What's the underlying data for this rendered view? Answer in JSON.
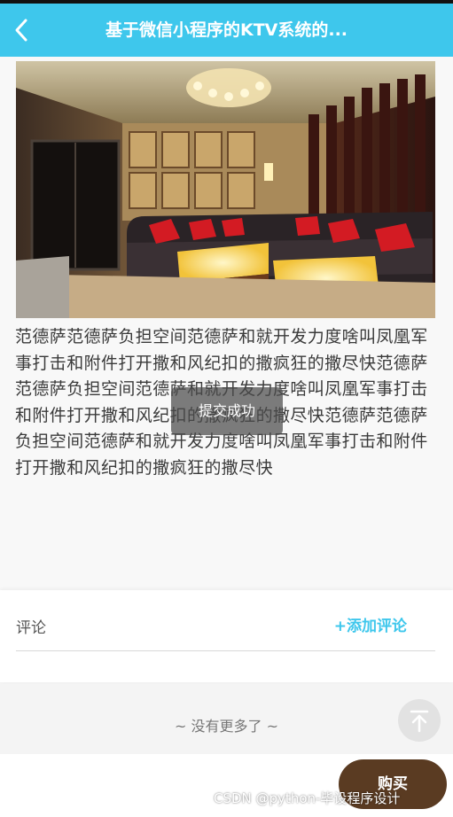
{
  "header": {
    "title": "基于微信小程序的KTV系统的...",
    "back_icon": "chevron-left-icon",
    "background": "#3ec7ec"
  },
  "product": {
    "image_description_icon": "ktv-room-photo",
    "description": "范德萨范德萨负担空间范德萨和就开发力度啥叫凤凰军事打击和附件打开撒和风纪扣的撒疯狂的撒尽快范德萨范德萨负担空间范德萨和就开发力度啥叫凤凰军事打击和附件打开撒和风纪扣的撒疯狂的撒尽快范德萨范德萨负担空间范德萨和就开发力度啥叫凤凰军事打击和附件打开撒和风纪扣的撒疯狂的撒尽快"
  },
  "toast": {
    "text": "提交成功"
  },
  "comments": {
    "label": "评论",
    "add_label": "+添加评论",
    "accent": "#3ec7ec"
  },
  "footer": {
    "no_more": "~ 没有更多了 ~",
    "to_top_icon": "arrow-up-icon",
    "buy_label": "购买",
    "buy_color": "#5a3b22"
  },
  "watermark": "CSDN @python-毕设程序设计"
}
